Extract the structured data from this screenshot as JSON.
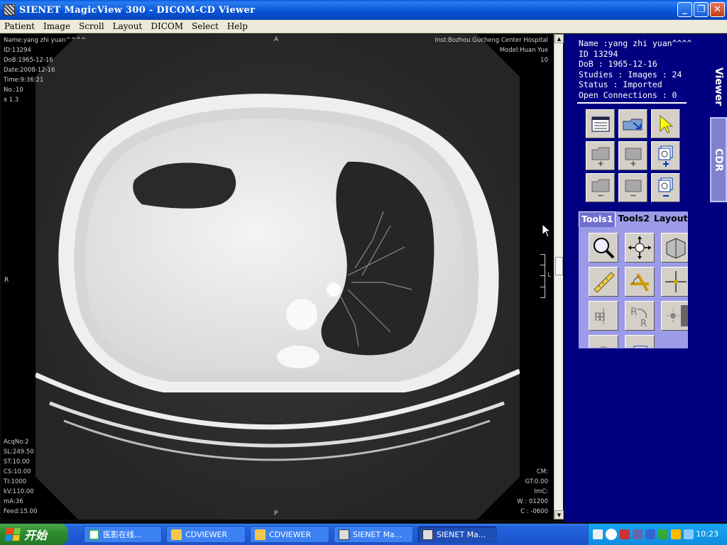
{
  "window": {
    "title": "SIENET MagicView 300  - DICOM-CD Viewer",
    "minimize": "_",
    "maximize": "❐",
    "close": "✕"
  },
  "menu": [
    "Patient",
    "Image",
    "Scroll",
    "Layout",
    "DICOM",
    "Select",
    "Help"
  ],
  "overlay": {
    "top_left": [
      "Name:yang zhi yuan^^^^",
      "ID:13294",
      "DoB:1965-12-16",
      "Date:2008-12-16",
      "Time:9:36:21",
      "No.:10",
      "x 1.3"
    ],
    "top_right": [
      "Inst:Bozhou Gucheng Center Hospital",
      "Model:Huan Yue",
      "10"
    ],
    "bottom_left": [
      "AcqNo:2",
      "SL:249.50",
      "ST:10.00",
      "CS:10.00",
      "TI:1000",
      "kV:110.00",
      "mA:36",
      "Feed:15.00"
    ],
    "bottom_right": [
      "CM:",
      "GT:0.00",
      "ImC:",
      "W : 01200",
      "C : -0600"
    ],
    "marker_top": "A",
    "marker_left": "R",
    "marker_bottom": "P",
    "marker_ruler": "L"
  },
  "patient_info": {
    "name": "Name :yang zhi yuan^^^^",
    "id": "ID 13294",
    "dob": "DoB : 1965-12-16",
    "studies": "Studies : Images : 24",
    "status": "Status : Imported",
    "connections": "Open Connections : 0"
  },
  "side_tabs": {
    "viewer": "Viewer",
    "cdr": "CDR"
  },
  "tool_tabs": [
    "Tools1",
    "Tools2",
    "Layout"
  ],
  "taskbar": {
    "start": "开始",
    "tasks": [
      "医影在线...",
      "CDVIEWER",
      "CDVIEWER",
      "SIENET Ma...",
      "SIENET Ma..."
    ],
    "clock": "10:23"
  },
  "colors": {
    "panel": "#000080",
    "tools_bg": "#9b9be8",
    "taskbar": "#2566de"
  }
}
